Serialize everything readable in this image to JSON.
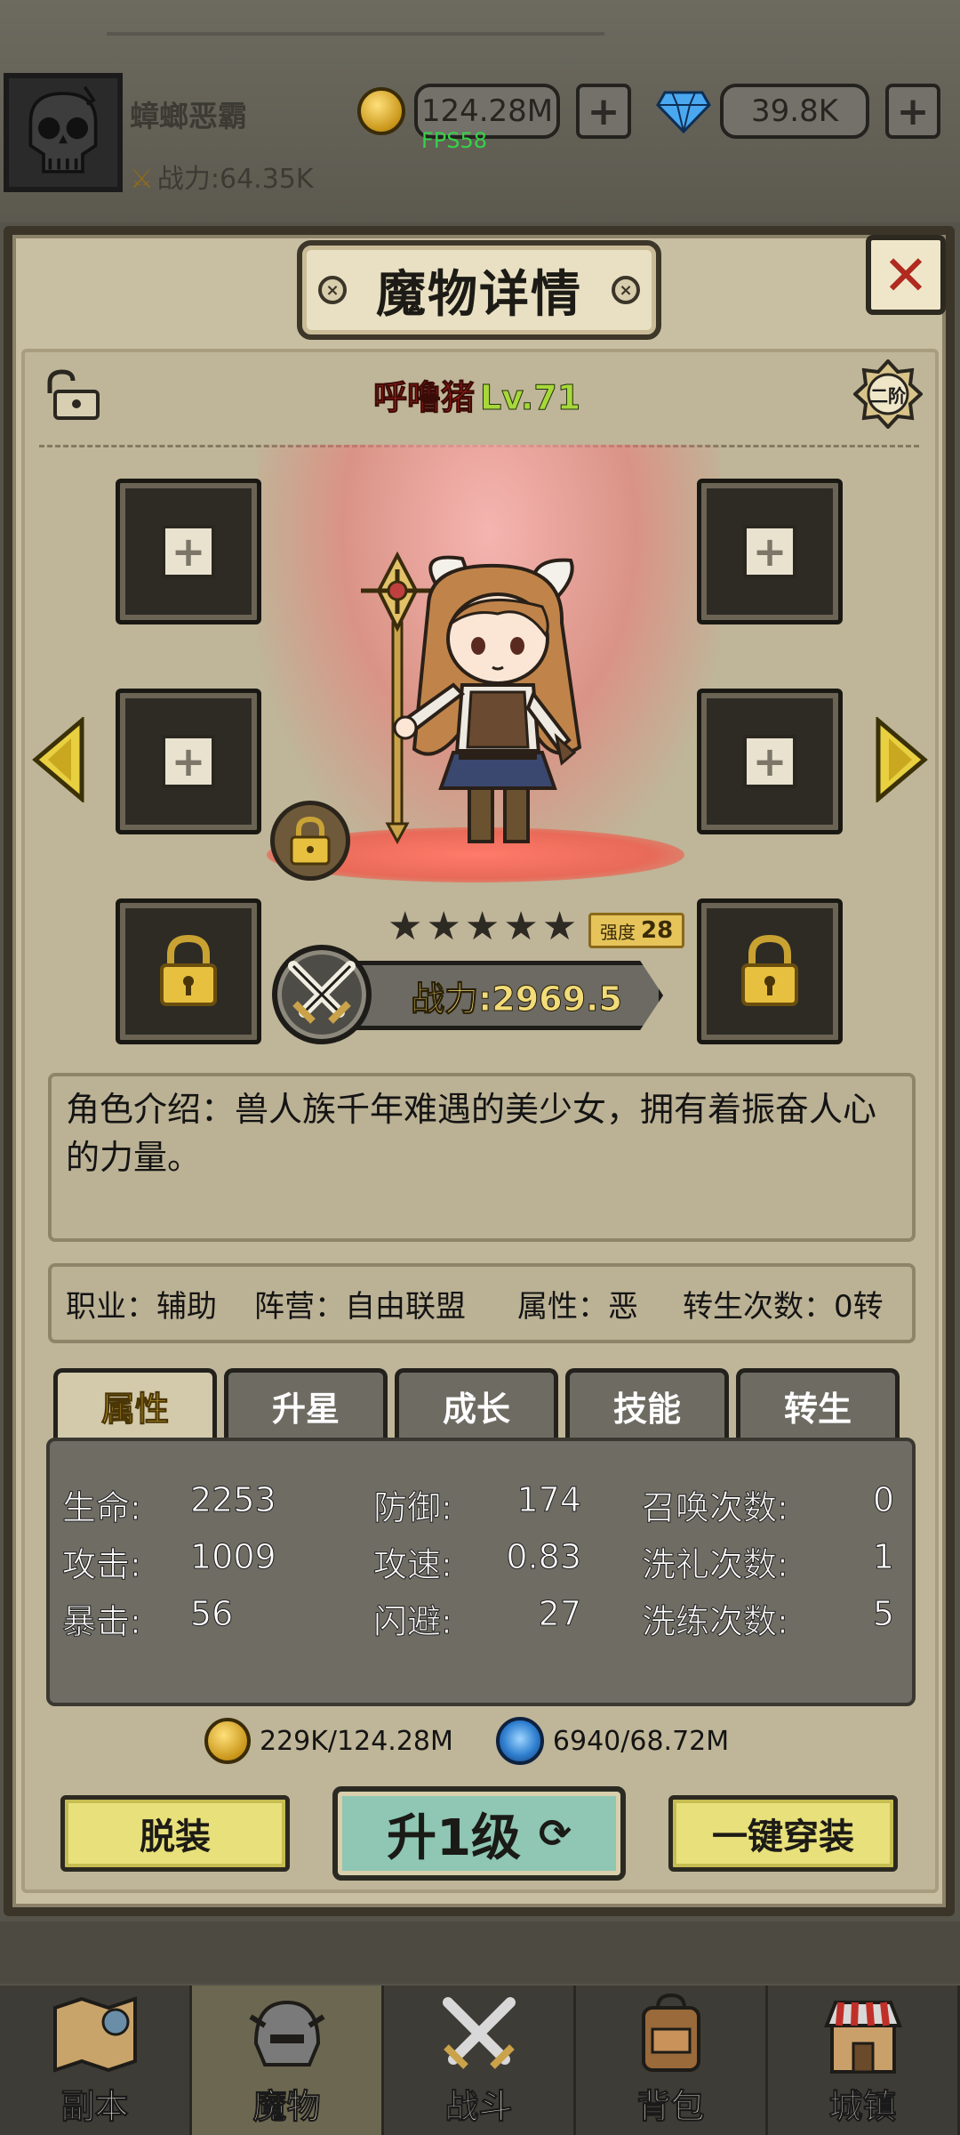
{
  "header": {
    "player_name": "蟑螂恶霸",
    "power": "战力:64.35K",
    "gold": "124.28M",
    "diamonds": "39.8K",
    "fps": "FPS58"
  },
  "dialog": {
    "title": "魔物详情",
    "monster_name": "呼噜猪",
    "monster_level": "Lv.71",
    "tier": "二阶",
    "strength_label": "强度",
    "strength_value": "28",
    "stars": 5,
    "combat_power": "战力:2969.5",
    "description": "角色介绍：兽人族千年难遇的美少女，拥有着振奋人心的力量。",
    "info": {
      "job": "职业：辅助",
      "camp": "阵营：自由联盟",
      "attribute": "属性：恶",
      "rebirth": "转生次数：0转"
    },
    "tabs": [
      "属性",
      "升星",
      "成长",
      "技能",
      "转生"
    ],
    "active_tab": 0,
    "stats": {
      "hp_label": "生命:",
      "hp": "2253",
      "atk_label": "攻击:",
      "atk": "1009",
      "crit_label": "暴击:",
      "crit": "56",
      "def_label": "防御:",
      "def": "174",
      "spd_label": "攻速:",
      "spd": "0.83",
      "dodge_label": "闪避:",
      "dodge": "27",
      "summon_label": "召唤次数:",
      "summon": "0",
      "baptism_label": "洗礼次数:",
      "baptism": "1",
      "refine_label": "洗练次数:",
      "refine": "5"
    },
    "cost_gold": "229K/124.28M",
    "cost_exp": "6940/68.72M",
    "buttons": {
      "unequip": "脱装",
      "upgrade": "升1级",
      "equip_all": "一键穿装"
    }
  },
  "nav": {
    "items": [
      "副本",
      "魔物",
      "战斗",
      "背包",
      "城镇"
    ],
    "active": 1
  },
  "colors": {
    "name_red": "#e0241a",
    "level_green": "#a6d83a",
    "power_gold": "#f2dc7a",
    "button_yellow": "#e8e07a",
    "upgrade_teal": "#8fc6b4"
  }
}
